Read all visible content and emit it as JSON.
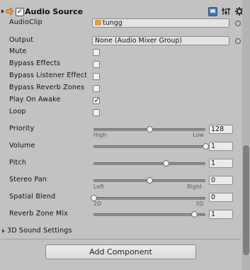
{
  "component": {
    "title": "Audio Source",
    "enabled": true
  },
  "fields": {
    "audio_clip": {
      "label": "AudioClip",
      "value": "tungg"
    },
    "output": {
      "label": "Output",
      "value": "None (Audio Mixer Group)"
    }
  },
  "toggles": {
    "mute": {
      "label": "Mute",
      "checked": false
    },
    "bypass_effects": {
      "label": "Bypass Effects",
      "checked": false
    },
    "bypass_listener": {
      "label": "Bypass Listener Effect",
      "checked": false
    },
    "bypass_reverb": {
      "label": "Bypass Reverb Zones",
      "checked": false
    },
    "play_on_awake": {
      "label": "Play On Awake",
      "checked": true
    },
    "loop": {
      "label": "Loop",
      "checked": false
    }
  },
  "sliders": {
    "priority": {
      "label": "Priority",
      "value": "128",
      "fraction": 0.5,
      "left_hint": "High",
      "right_hint": "Low"
    },
    "volume": {
      "label": "Volume",
      "value": "1",
      "fraction": 1.0
    },
    "pitch": {
      "label": "Pitch",
      "value": "1",
      "fraction": 0.65
    },
    "stereo_pan": {
      "label": "Stereo Pan",
      "value": "0",
      "fraction": 0.5,
      "left_hint": "Left",
      "right_hint": "Right"
    },
    "spatial_blend": {
      "label": "Spatial Blend",
      "value": "0",
      "fraction": 0.0,
      "left_hint": "2D",
      "right_hint": "3D"
    },
    "reverb_zone_mix": {
      "label": "Reverb Zone Mix",
      "value": "1",
      "fraction": 0.9
    }
  },
  "sound_settings": {
    "label": "3D Sound Settings"
  },
  "add_component": {
    "label": "Add Component"
  },
  "icons": {
    "fold": "triangle-right-icon",
    "component": "speaker-icon",
    "help": "book-icon",
    "preset": "sliders-icon",
    "settings": "gear-icon",
    "picker": "target-circle-icon",
    "check": "checkmark-icon"
  }
}
